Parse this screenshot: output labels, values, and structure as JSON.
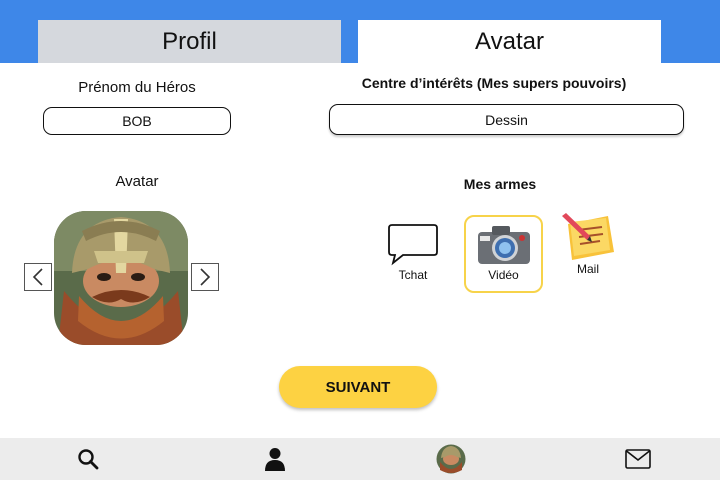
{
  "tabs": [
    {
      "label": "Profil",
      "active": false
    },
    {
      "label": "Avatar",
      "active": true
    }
  ],
  "profile": {
    "hero_name_label": "Prénom du Héros",
    "hero_name_value": "BOB",
    "avatar_label": "Avatar"
  },
  "interests": {
    "label": "Centre d’intérêts (Mes supers pouvoirs)",
    "value": "Dessin"
  },
  "weapons": {
    "label": "Mes armes",
    "items": [
      {
        "label": "Tchat",
        "icon": "speech-bubble-icon",
        "selected": false
      },
      {
        "label": "Vidéo",
        "icon": "camera-icon",
        "selected": true
      },
      {
        "label": "Mail",
        "icon": "notepad-icon",
        "selected": false
      }
    ]
  },
  "next_button": "SUIVANT",
  "bottom_nav": [
    "search-icon",
    "user-icon",
    "avatar-icon",
    "mail-icon"
  ],
  "colors": {
    "header_blue": "#3e87e8",
    "inactive_tab": "#d5d8dd",
    "accent_yellow": "#fdd242",
    "bottom_bar": "#ececec"
  }
}
